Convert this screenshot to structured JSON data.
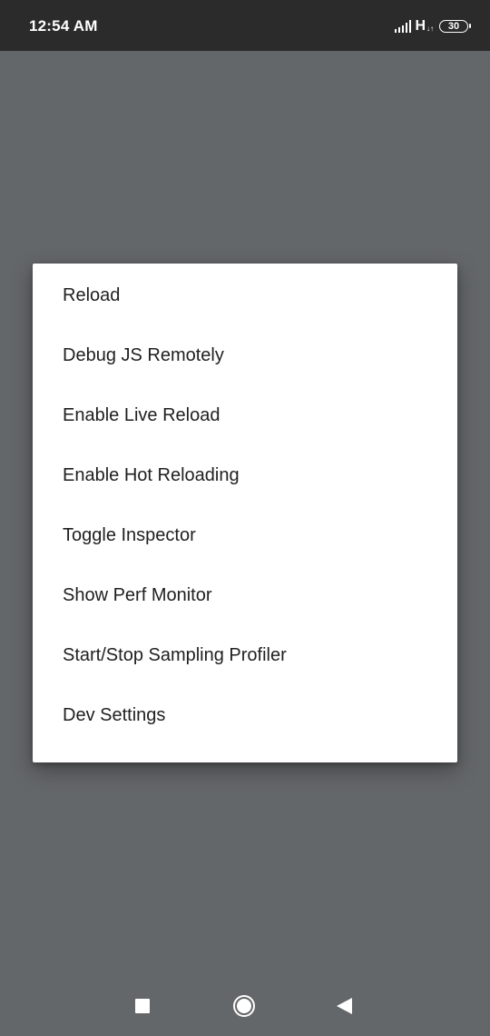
{
  "status_bar": {
    "time": "12:54 AM",
    "network_type": "H",
    "network_activity": "↓↑",
    "battery_level": "30",
    "icons": [
      "signal-icon",
      "battery-icon"
    ]
  },
  "dev_menu": {
    "items": [
      {
        "label": "Reload"
      },
      {
        "label": "Debug JS Remotely"
      },
      {
        "label": "Enable Live Reload"
      },
      {
        "label": "Enable Hot Reloading"
      },
      {
        "label": "Toggle Inspector"
      },
      {
        "label": "Show Perf Monitor"
      },
      {
        "label": "Start/Stop Sampling Profiler"
      },
      {
        "label": "Dev Settings"
      }
    ]
  },
  "nav_bar": {
    "icons": [
      "recents-icon",
      "home-icon",
      "back-icon"
    ]
  },
  "colors": {
    "scrim": "#646769",
    "status_bar": "#2b2b2b",
    "dialog": "#ffffff",
    "text": "#1f1f1f"
  }
}
